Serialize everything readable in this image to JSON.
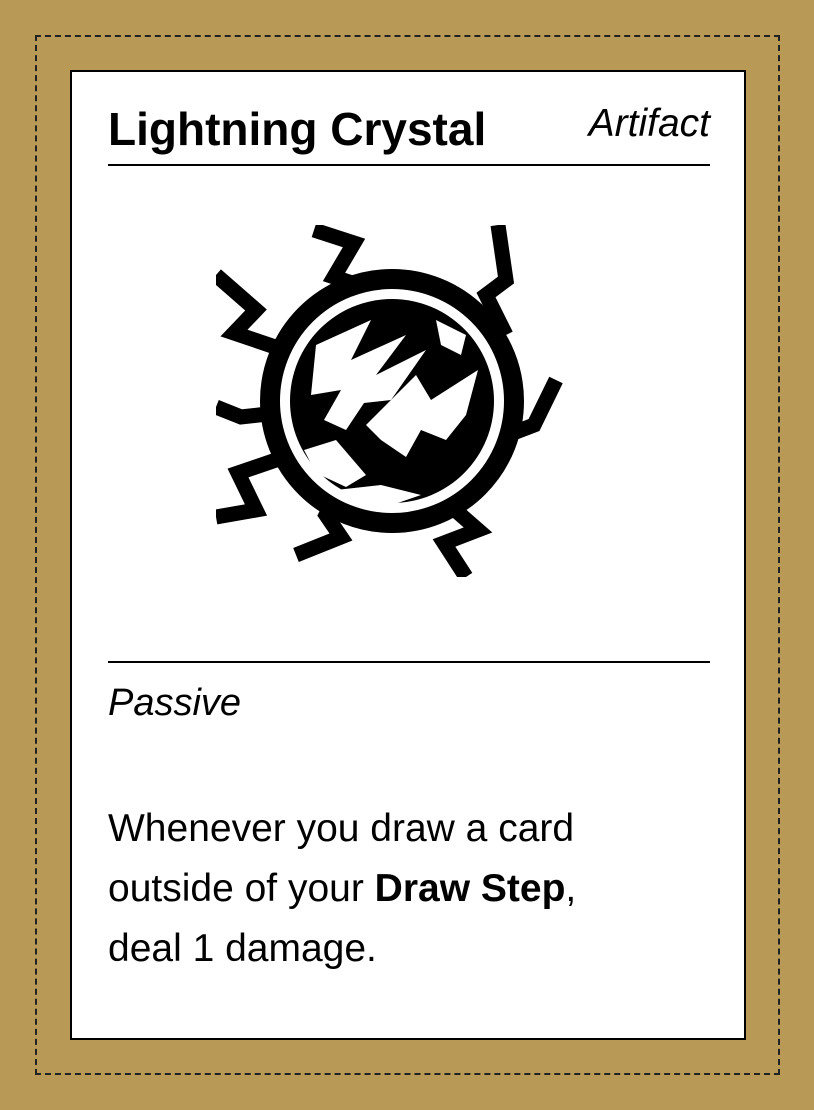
{
  "card": {
    "name": "Lightning Crystal",
    "type": "Artifact",
    "art_icon": "lightning-crystal-icon",
    "keyword": "Passive",
    "text": {
      "line1": "Whenever you draw a card",
      "line2_pre": "outside of your ",
      "line2_bold": "Draw Step",
      "line2_post": ",",
      "line3": "deal 1 damage."
    }
  },
  "colors": {
    "background": "#B89A56",
    "card": "#FFFFFF",
    "ink": "#000000"
  }
}
